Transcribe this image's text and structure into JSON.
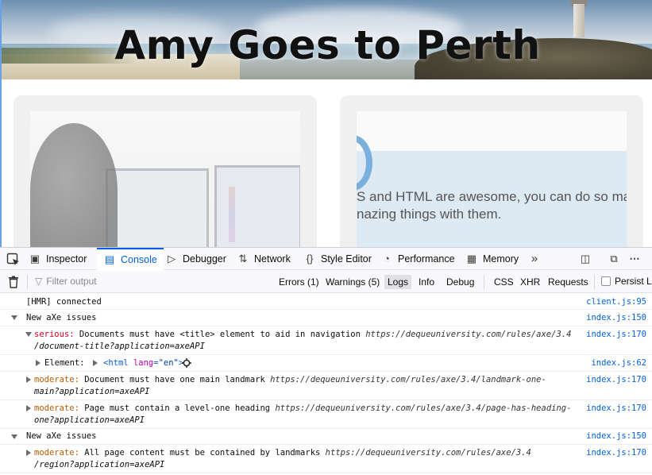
{
  "site": {
    "title": "Amy Goes to Perth",
    "card_right_text": [
      "S and HTML are awesome, you can do so many",
      "nazing things with them."
    ]
  },
  "devtools": {
    "tabs": [
      {
        "label": "Inspector",
        "icon": "inspector-icon"
      },
      {
        "label": "Console",
        "icon": "console-icon",
        "active": true
      },
      {
        "label": "Debugger",
        "icon": "debugger-icon"
      },
      {
        "label": "Network",
        "icon": "network-icon"
      },
      {
        "label": "Style Editor",
        "icon": "style-editor-icon"
      },
      {
        "label": "Performance",
        "icon": "performance-icon"
      },
      {
        "label": "Memory",
        "icon": "memory-icon"
      }
    ],
    "filter_placeholder": "Filter output",
    "filters": {
      "errors": "Errors (1)",
      "warnings": "Warnings (5)",
      "logs": "Logs",
      "info": "Info",
      "debug": "Debug",
      "css": "CSS",
      "xhr": "XHR",
      "requests": "Requests"
    },
    "persist_logs": "Persist Lo",
    "colors": {
      "accent": "#0061e0",
      "error": "#d70022",
      "warning": "#c25a00"
    }
  },
  "log": {
    "hmr": {
      "text": "[HMR] connected",
      "src": "client.js:95"
    },
    "group1": {
      "text": "New aXe issues",
      "src": "index.js:150"
    },
    "e1": {
      "sev": "serious:",
      "text": " Documents must have <title> element to aid in navigation ",
      "url1": "https://dequeuniversity.com/rules/axe/3.4",
      "url2": "/document-title?application=axeAPI",
      "src": "index.js:170"
    },
    "el": {
      "label": "Element:",
      "tag_open": "<html ",
      "attr": "lang",
      "eq": "=",
      "val": "\"en\"",
      "tag_close": ">",
      "src": "index.js:62"
    },
    "e2": {
      "sev": "moderate:",
      "text": " Document must have one main landmark ",
      "url1": "https://dequeuniversity.com/rules/axe/3.4/landmark-one-",
      "url2": "main?application=axeAPI",
      "src": "index.js:170"
    },
    "e3": {
      "sev": "moderate:",
      "text": " Page must contain a level-one heading ",
      "url1": "https://dequeuniversity.com/rules/axe/3.4/page-has-heading-",
      "url2": "one?application=axeAPI",
      "src": "index.js:170"
    },
    "group2": {
      "text": "New aXe issues",
      "src": "index.js:150"
    },
    "e4": {
      "sev": "moderate:",
      "text": " All page content must be contained by landmarks ",
      "url1": "https://dequeuniversity.com/rules/axe/3.4",
      "url2": "/region?application=axeAPI",
      "src": "index.js:170"
    }
  }
}
